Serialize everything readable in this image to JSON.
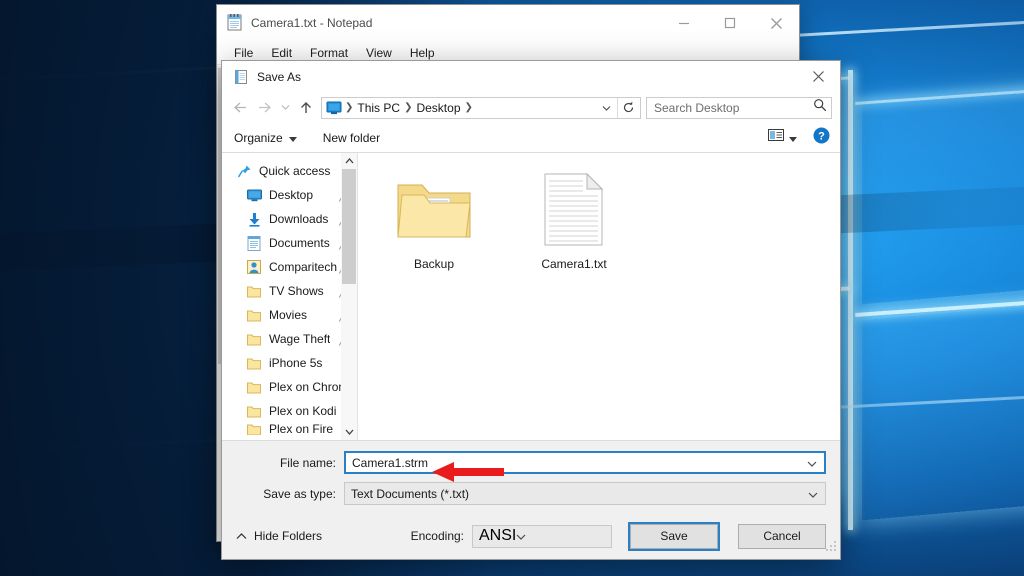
{
  "desktop": {
    "wallpaper_name": "windows-10-hero-wallpaper",
    "accent_color": "#1581d4"
  },
  "notepad": {
    "icon": "notepad-icon",
    "title": "Camera1.txt - Notepad",
    "caption": {
      "minimize": "minimize-icon",
      "maximize": "maximize-icon",
      "close": "close-icon"
    },
    "menu": [
      "File",
      "Edit",
      "Format",
      "View",
      "Help"
    ]
  },
  "save_as": {
    "icon": "save-dialog-icon",
    "title": "Save As",
    "close_icon": "close-icon",
    "nav": {
      "back_icon": "arrow-left-icon",
      "forward_icon": "arrow-right-icon",
      "recent_icon": "chevron-down-icon",
      "up_icon": "arrow-up-icon",
      "breadcrumb_icon": "monitor-icon",
      "breadcrumb": [
        "This PC",
        "Desktop"
      ],
      "breadcrumb_dropdown_icon": "chevron-down-icon",
      "refresh_icon": "refresh-icon"
    },
    "search": {
      "placeholder": "Search Desktop",
      "icon": "search-icon",
      "value": ""
    },
    "toolbar": {
      "organize_label": "Organize",
      "organize_caret_icon": "caret-down-icon",
      "new_folder_label": "New folder",
      "view_icon": "view-layout-icon",
      "view_caret_icon": "caret-down-icon",
      "help_icon": "help-icon"
    },
    "sidebar": {
      "scroll_up_icon": "chevron-up-icon",
      "scroll_down_icon": "chevron-down-icon",
      "items": [
        {
          "label": "Quick access",
          "icon": "pin-star-icon",
          "pinned": false,
          "indent": false
        },
        {
          "label": "Desktop",
          "icon": "desktop-icon",
          "pinned": true,
          "indent": true
        },
        {
          "label": "Downloads",
          "icon": "downloads-icon",
          "pinned": true,
          "indent": true
        },
        {
          "label": "Documents",
          "icon": "documents-icon",
          "pinned": true,
          "indent": true
        },
        {
          "label": "Comparitech",
          "icon": "user-folder-icon",
          "pinned": true,
          "indent": true
        },
        {
          "label": "TV Shows",
          "icon": "folder-icon",
          "pinned": true,
          "indent": true
        },
        {
          "label": "Movies",
          "icon": "folder-icon",
          "pinned": true,
          "indent": true
        },
        {
          "label": "Wage Theft",
          "icon": "folder-icon",
          "pinned": true,
          "indent": true
        },
        {
          "label": "iPhone 5s",
          "icon": "folder-icon",
          "pinned": false,
          "indent": true
        },
        {
          "label": "Plex on Chromecast",
          "icon": "folder-icon",
          "pinned": false,
          "indent": true
        },
        {
          "label": "Plex on Kodi",
          "icon": "folder-icon",
          "pinned": false,
          "indent": true
        },
        {
          "label": "Plex on Fire",
          "icon": "folder-icon",
          "pinned": false,
          "indent": true
        }
      ]
    },
    "files": [
      {
        "name": "Backup",
        "type": "folder"
      },
      {
        "name": "Camera1.txt",
        "type": "text-file"
      }
    ],
    "fields": {
      "file_name_label": "File name:",
      "file_name_value": "Camera1.strm",
      "file_name_caret_icon": "chevron-down-icon",
      "save_as_type_label": "Save as type:",
      "save_as_type_value": "Text Documents (*.txt)",
      "save_as_type_caret_icon": "chevron-down-icon"
    },
    "footer": {
      "hide_folders_label": "Hide Folders",
      "hide_folders_icon": "chevron-up-icon",
      "encoding_label": "Encoding:",
      "encoding_value": "ANSI",
      "encoding_caret_icon": "chevron-down-icon",
      "save_label": "Save",
      "cancel_label": "Cancel"
    }
  },
  "annotation": {
    "arrow_icon": "red-arrow-left",
    "color": "#e81c1c",
    "points_at": "file_name_value"
  }
}
